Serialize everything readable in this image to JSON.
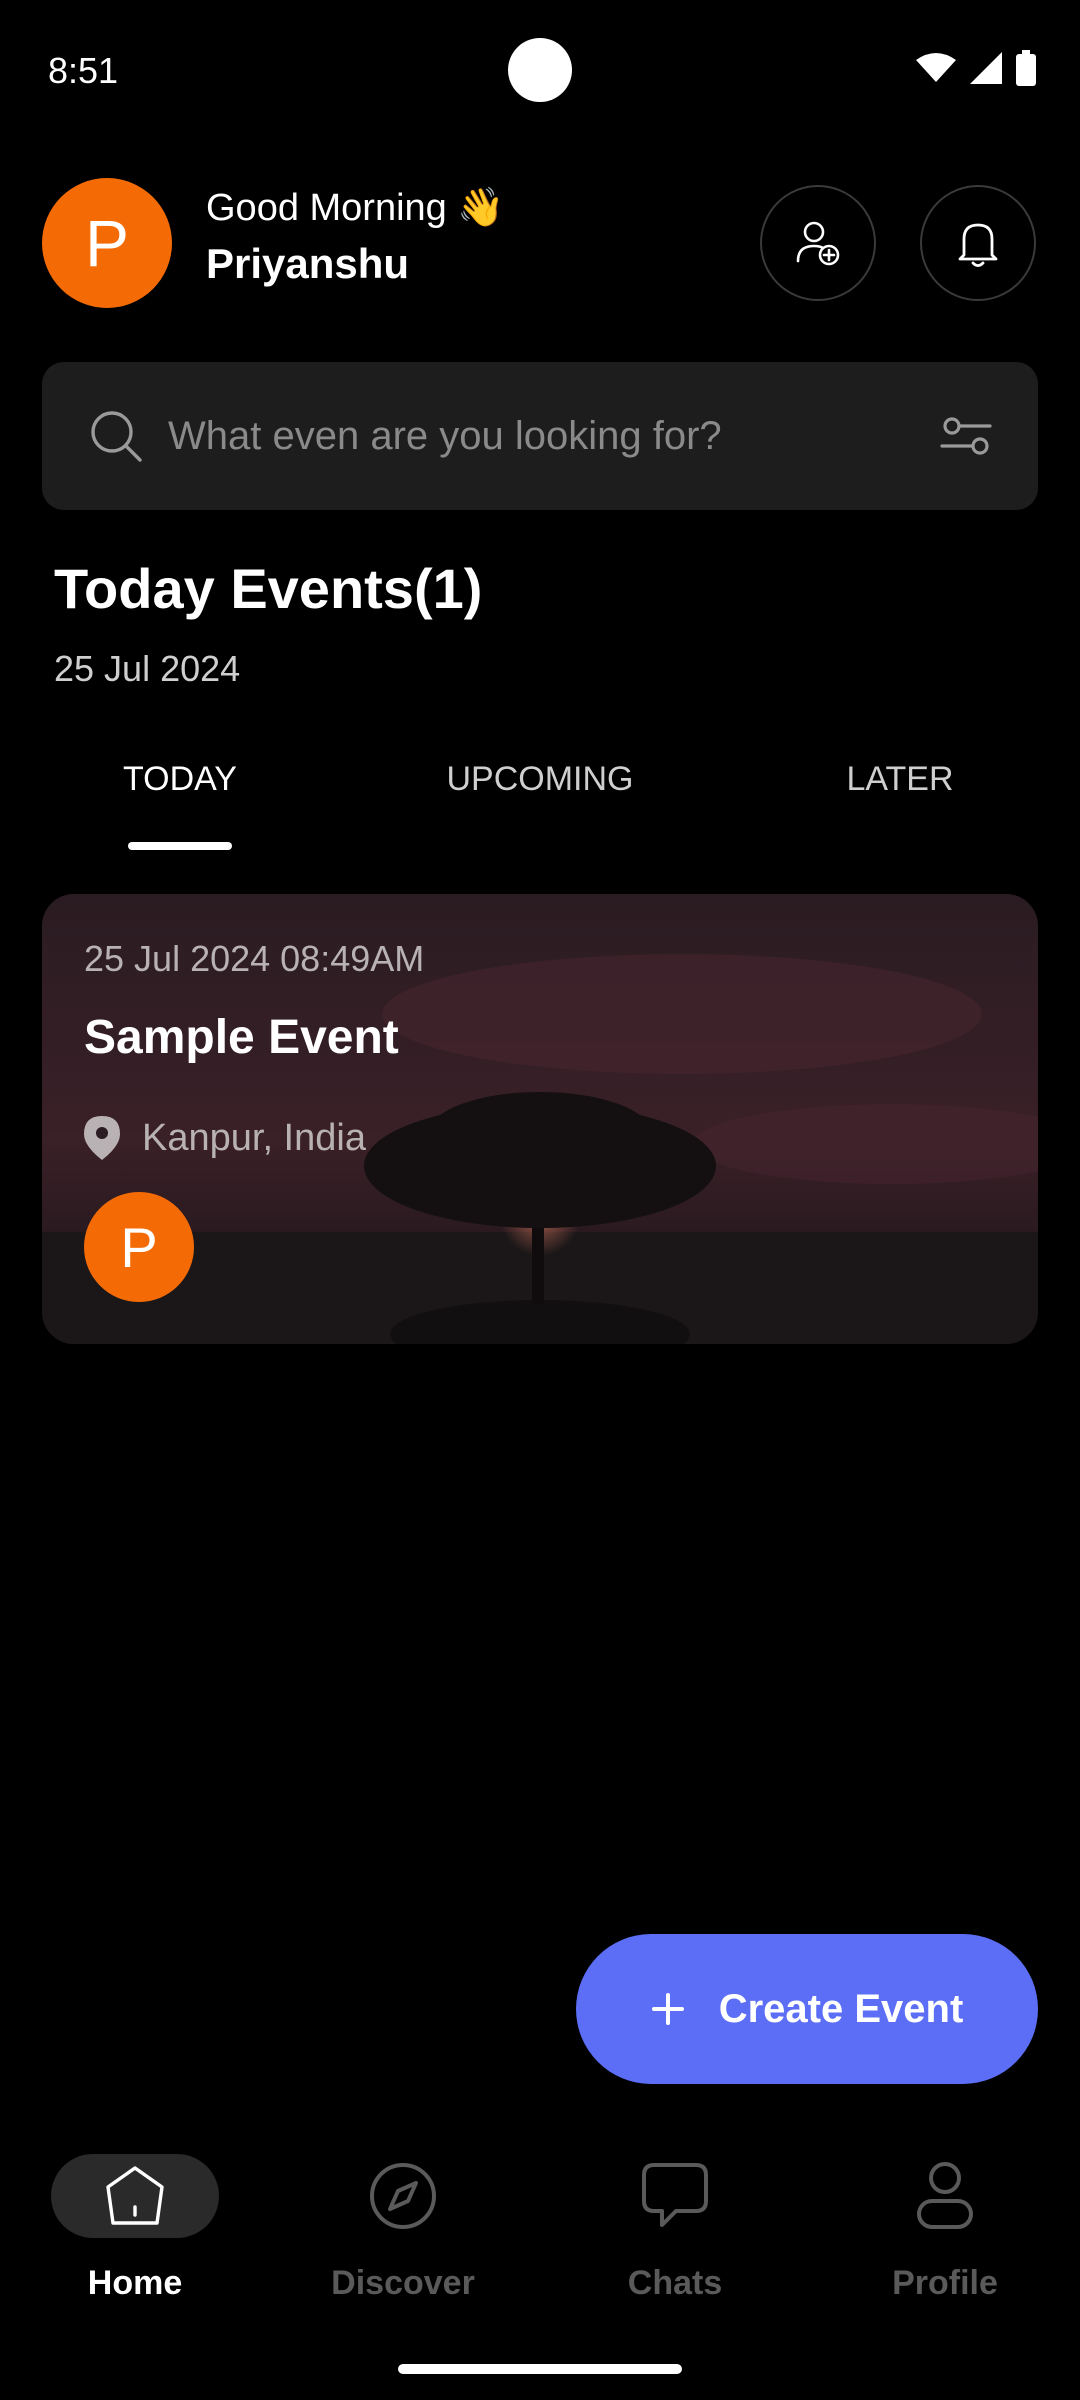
{
  "status_bar": {
    "time": "8:51"
  },
  "header": {
    "avatar_initial": "P",
    "greeting": "Good Morning 👋",
    "username": "Priyanshu"
  },
  "search": {
    "placeholder": "What even are you looking for?"
  },
  "section": {
    "title": "Today Events(1)",
    "date": "25 Jul 2024"
  },
  "tabs": [
    {
      "label": "TODAY",
      "selected": true
    },
    {
      "label": "UPCOMING",
      "selected": false
    },
    {
      "label": "LATER",
      "selected": false
    }
  ],
  "events": [
    {
      "datetime": "25 Jul 2024 08:49AM",
      "title": "Sample Event",
      "location": "Kanpur, India",
      "attendee_initial": "P"
    }
  ],
  "fab": {
    "label": "Create Event"
  },
  "nav": [
    {
      "label": "Home",
      "icon": "home-icon",
      "active": true
    },
    {
      "label": "Discover",
      "icon": "compass-icon",
      "active": false
    },
    {
      "label": "Chats",
      "icon": "chat-icon",
      "active": false
    },
    {
      "label": "Profile",
      "icon": "profile-icon",
      "active": false
    }
  ],
  "colors": {
    "accent": "#5b6ef5",
    "avatar": "#f46b06",
    "background": "#000000",
    "surface": "#1d1d1d"
  }
}
